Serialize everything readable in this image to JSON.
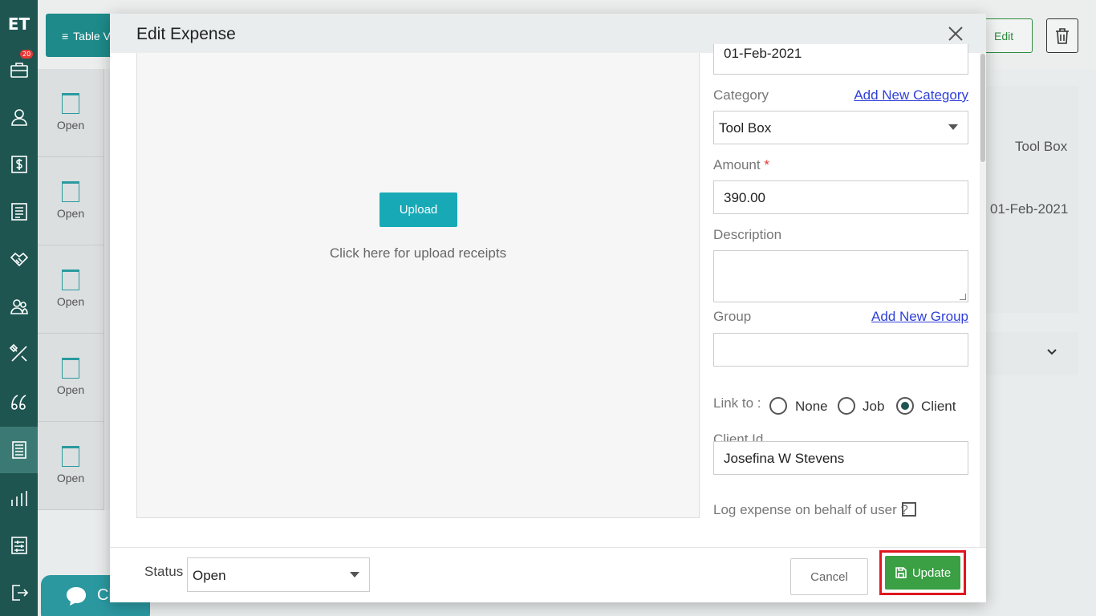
{
  "app": {
    "logo": "ET",
    "notification_count": "20"
  },
  "background": {
    "table_view_label": "Table V",
    "edit_label": "Edit",
    "list_items": [
      "Open",
      "Open",
      "Open",
      "Open",
      "Open"
    ],
    "detail_category": "Tool Box",
    "detail_date": "01-Feb-2021",
    "chat_label": "Ch"
  },
  "modal": {
    "title": "Edit Expense",
    "upload": {
      "button_label": "Upload",
      "hint": "Click here for upload receipts"
    },
    "date_value": "01-Feb-2021",
    "category": {
      "label": "Category",
      "link": "Add New Category",
      "value": "Tool Box"
    },
    "amount": {
      "label": "Amount",
      "required_mark": "*",
      "value": "390.00"
    },
    "description": {
      "label": "Description",
      "value": ""
    },
    "group": {
      "label": "Group",
      "link": "Add New Group",
      "value": ""
    },
    "link_to": {
      "label": "Link to :",
      "options": [
        "None",
        "Job",
        "Client"
      ],
      "selected": "Client"
    },
    "client_id": {
      "label": "Client Id",
      "value": "Josefina W Stevens"
    },
    "log_behalf": {
      "label": "Log expense on behalf of user ?",
      "checked": false
    },
    "footer": {
      "status_label": "Status",
      "status_value": "Open",
      "cancel_label": "Cancel",
      "update_label": "Update"
    }
  },
  "colors": {
    "nav_bg": "#1e5551",
    "accent_teal": "#17a9b6",
    "update_green": "#3aa043",
    "highlight_red": "#e0161e",
    "link_blue": "#3040d8"
  }
}
